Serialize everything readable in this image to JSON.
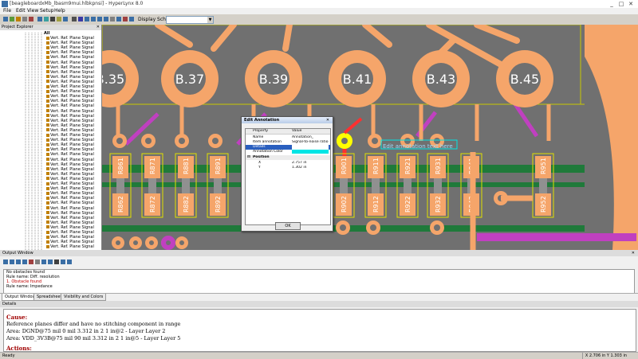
{
  "window": {
    "title": "[beagleboardxMb_lbasm9mui.hlbkpnsi] - HyperLynx 8.0",
    "min": "_",
    "max": "□",
    "close": "✕"
  },
  "menu": [
    "File",
    "Edit",
    "View",
    "Setup",
    "Help"
  ],
  "toolbar": {
    "display_scheme_label": "Display Scheme",
    "display_scheme_value": ""
  },
  "project_explorer": {
    "title": "Project Explorer",
    "close": "✕",
    "root": "All",
    "items": [
      "Vert. Ref. Plane Signal",
      "Vert. Ref. Plane Signal",
      "Vert. Ref. Plane Signal",
      "Vert. Ref. Plane Signal",
      "Vert. Ref. Plane Signal",
      "Vert. Ref. Plane Signal",
      "Vert. Ref. Plane Signal",
      "Vert. Ref. Plane Signal",
      "Vert. Ref. Plane Signal",
      "Vert. Ref. Plane Signal",
      "Vert. Ref. Plane Signal",
      "Vert. Ref. Plane Signal",
      "Vert. Ref. Plane Signal",
      "Vert. Ref. Plane Signal",
      "Vert. Ref. Plane Signal",
      "Vert. Ref. Plane Signal",
      "Vert. Ref. Plane Signal",
      "Vert. Ref. Plane Signal",
      "Vert. Ref. Plane Signal",
      "Vert. Ref. Plane Signal",
      "Vert. Ref. Plane Signal",
      "Vert. Ref. Plane Signal",
      "Vert. Ref. Plane Signal",
      "Vert. Ref. Plane Signal",
      "Vert. Ref. Plane Signal",
      "Vert. Ref. Plane Signal",
      "Vert. Ref. Plane Signal",
      "Vert. Ref. Plane Signal",
      "Vert. Ref. Plane Signal",
      "Vert. Ref. Plane Signal",
      "Vert. Ref. Plane Signal",
      "Vert. Ref. Plane Signal",
      "Vert. Ref. Plane Signal",
      "Vert. Ref. Plane Signal",
      "Vert. Ref. Plane Signal",
      "Vert. Ref. Plane Signal",
      "Vert. Ref. Plane Signal",
      "Vert. Ref. Plane Signal",
      "Vert. Ref. Plane Signal",
      "Vert. Ref. Plane Signal",
      "Vert. Ref. Plane Signal",
      "Vert. Ref. Plane Signal",
      "Vert. Ref. Plane Signal",
      "Vert. Ref. Plane Signal"
    ]
  },
  "pcb": {
    "big_pads": [
      "B.35",
      "B.37",
      "B.39",
      "B.41",
      "B.43",
      "B.45"
    ],
    "components": [
      "R861",
      "R871",
      "R881",
      "R891",
      "R901",
      "R911",
      "R921",
      "R931",
      "R941",
      "R951",
      "R961",
      "R971"
    ],
    "components_bottom": [
      "R862",
      "R872",
      "R882",
      "R892",
      "R902",
      "R912",
      "R922",
      "R932",
      "R942",
      "R952",
      "R962",
      "R972"
    ],
    "annotation_text": "Edit annotation text here",
    "colors": {
      "board": "#707070",
      "copper": "#f5a56a",
      "trace_green": "#1f7a3a",
      "magenta": "#c040c0",
      "highlight": "#ffff00"
    }
  },
  "dialog": {
    "title": "Edit Annotation",
    "close": "✕",
    "col_property": "Property",
    "col_value": "Value",
    "rows": [
      {
        "key": "Name",
        "value": "Annotation_"
      },
      {
        "key": "Item annotation",
        "value": "Signal-to-noise ratio"
      },
      {
        "key": "Details",
        "value": ""
      },
      {
        "key": "Annotation Color",
        "value": ""
      }
    ],
    "position_label": "Position",
    "pos_rows": [
      {
        "key": "X",
        "value": "2.757 in"
      },
      {
        "key": "Y",
        "value": "1.302 in"
      }
    ],
    "ok": "OK"
  },
  "output_window": {
    "title": "Output Window",
    "close": "✕",
    "lines": [
      {
        "text": "No obstacles found",
        "color": "#000"
      },
      {
        "text": "Rule name: Diff. resolution",
        "color": "#000"
      },
      {
        "text": "1. Obstacle found",
        "color": "#c00000"
      },
      {
        "text": "Rule name: Impedance",
        "color": "#000"
      }
    ]
  },
  "tabs": [
    "Output Window",
    "Spreadsheet",
    "Visibility and Colors"
  ],
  "details": {
    "title": "Details",
    "cause_label": "Cause:",
    "line1": "Reference planes differ and have no stitching component in range",
    "line2": "Area: DGND@75 mil 0 mil 3.312 in 2 1 in@2 - Layer Layer 2",
    "line3": "Area: VDD_3V3B@75 mil 90 mil 3.312 in 2 1 in@5 - Layer Layer 5",
    "actions_label": "Actions:"
  },
  "status": {
    "left": "Ready",
    "coord": "X 2.706 in  Y 1.303 in"
  }
}
